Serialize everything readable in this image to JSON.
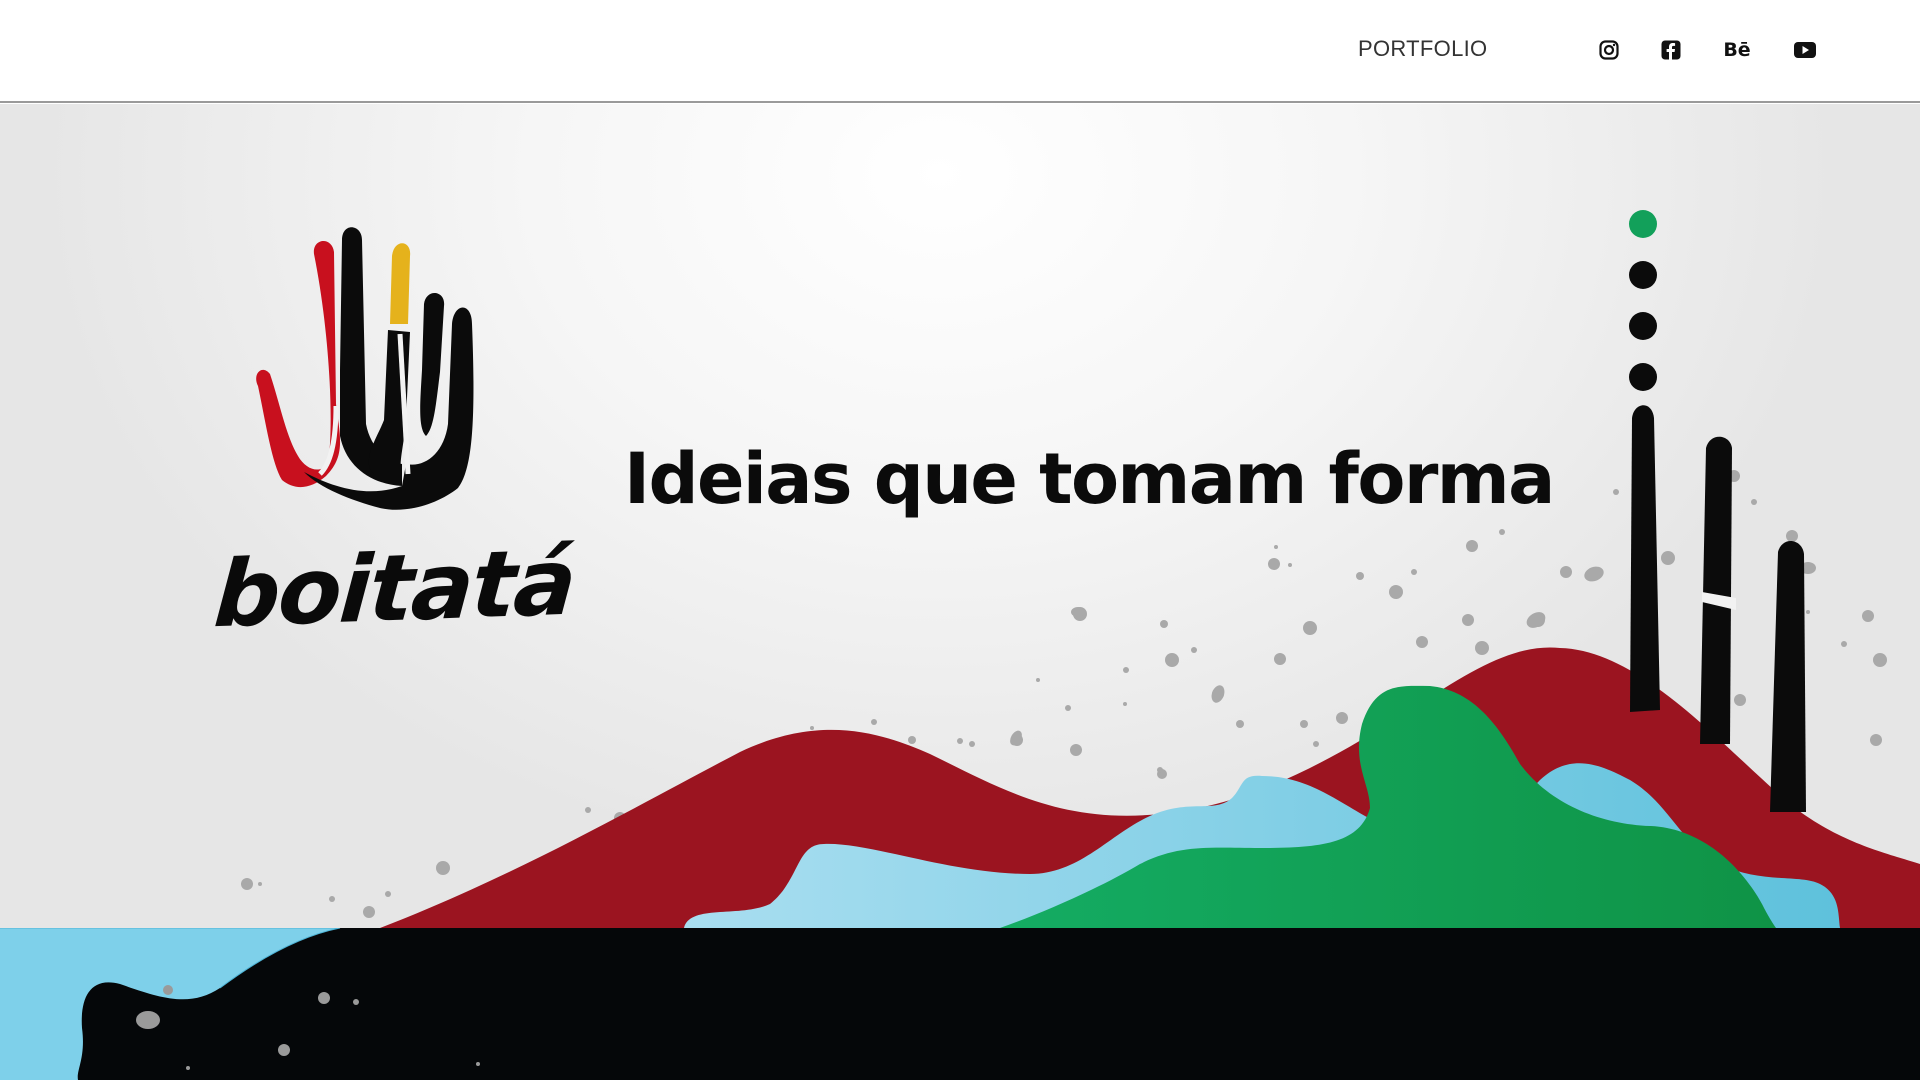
{
  "nav": {
    "portfolio_label": "PORTFOLIO",
    "social": [
      {
        "name": "instagram",
        "icon": "instagram-icon"
      },
      {
        "name": "facebook",
        "icon": "facebook-icon"
      },
      {
        "name": "behance",
        "icon": "behance-icon",
        "glyph": "Bē"
      },
      {
        "name": "youtube",
        "icon": "youtube-icon"
      }
    ]
  },
  "hero": {
    "logo_text": "boitatá",
    "headline": "Ideias que tomam forma",
    "slider": {
      "count": 4,
      "active_index": 0
    }
  },
  "colors": {
    "red": "#9b1420",
    "green": "#12a05a",
    "light_blue": "#6cc7df",
    "yellow": "#e5b21c",
    "black": "#0b0b0b",
    "dark_band": "#050709",
    "active_dot": "#12a05a"
  }
}
